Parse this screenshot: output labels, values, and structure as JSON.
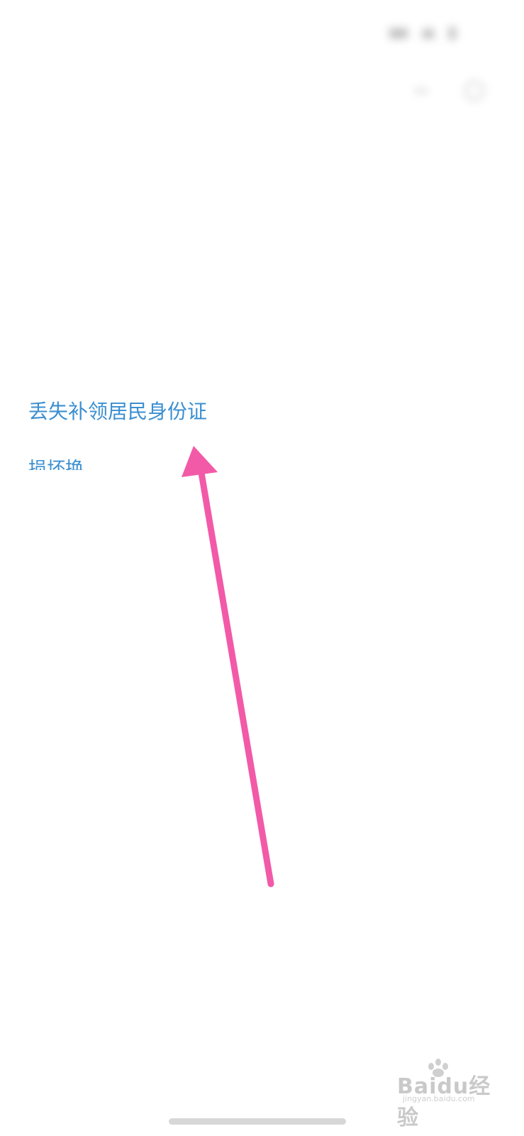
{
  "status_bar": {
    "left_text": "",
    "icons": [
      "signal-icon",
      "wifi-icon",
      "battery-icon"
    ]
  },
  "nav": {
    "title": "",
    "icons": [
      "more-icon",
      "settings-icon"
    ]
  },
  "sections": [
    {
      "title": "",
      "more": "",
      "items": [
        "",
        "",
        "丢失补领居民身份证",
        "损坏换"
      ]
    },
    {
      "title": "",
      "more": "",
      "items": [
        "",
        ""
      ]
    },
    {
      "title": "",
      "more": "",
      "items": [
        "",
        "",
        "",
        ""
      ]
    }
  ],
  "annotation": {
    "color": "#f25aa8",
    "icon": "arrow-icon"
  },
  "watermark": {
    "logo": "Baidu经验",
    "sub": "jingyan.baidu.com"
  }
}
